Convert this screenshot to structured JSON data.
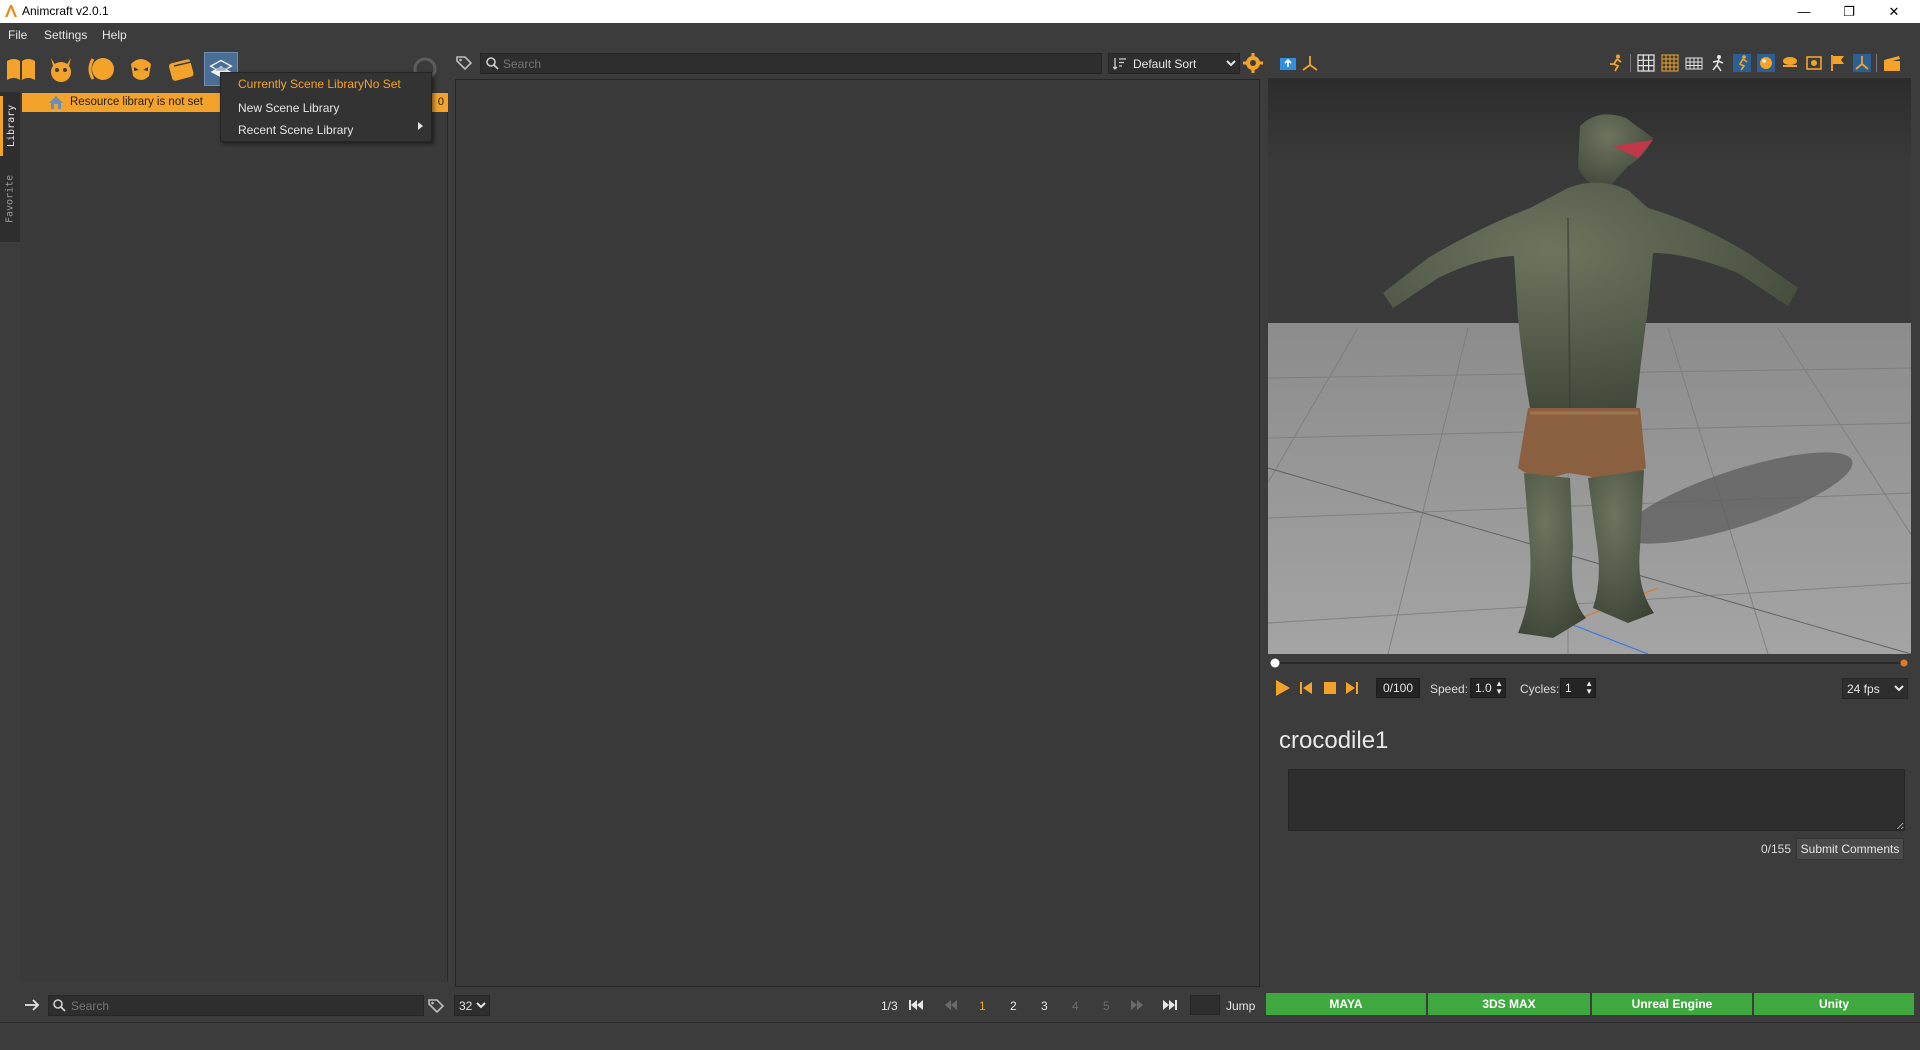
{
  "window": {
    "title": "Animcraft v2.0.1",
    "minimize": "—",
    "restore": "❐",
    "close": "✕"
  },
  "menubar": {
    "items": [
      "File",
      "Settings",
      "Help"
    ]
  },
  "side_tabs": [
    "Library",
    "Favorite"
  ],
  "library": {
    "resource_status": "Resource library is not set",
    "count": "0"
  },
  "scene_menu": {
    "current": "Currently Scene LibraryNo Set",
    "new": "New Scene Library",
    "recent": "Recent Scene Library"
  },
  "center": {
    "search_placeholder": "Search",
    "sort_value": "Default Sort",
    "sort_options": [
      "Default Sort"
    ]
  },
  "viewport": {
    "frame": "0/100",
    "speed_label": "Speed:",
    "speed": "1.0",
    "cycles_label": "Cycles:",
    "cycles": "1",
    "fps": "24 fps",
    "fps_options": [
      "24 fps"
    ]
  },
  "asset": {
    "name": "crocodile1",
    "char_count": "0/155",
    "submit_label": "Submit Comments"
  },
  "bottom": {
    "search_placeholder": "Search",
    "page_size": "32",
    "page_size_options": [
      "32"
    ],
    "page_info": "1/3",
    "pages": [
      "1",
      "2",
      "3",
      "4",
      "5"
    ],
    "jump_label": "Jump"
  },
  "export": {
    "maya": "MAYA",
    "max": "3DS MAX",
    "unreal": "Unreal Engine",
    "unity": "Unity"
  },
  "colors": {
    "accent": "#f4a32a",
    "export_green": "#3fa83f",
    "bg": "#3c3c3c"
  }
}
